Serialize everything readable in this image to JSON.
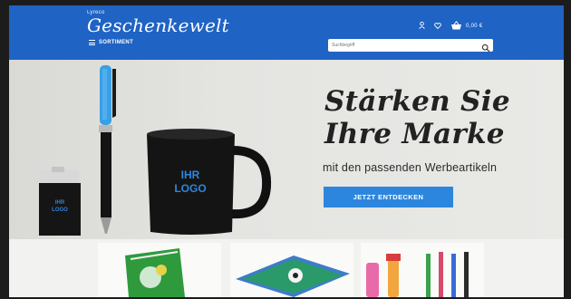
{
  "header": {
    "brand_small": "Lyreco",
    "brand_main": "Geschenkewelt",
    "menu_label": "SORTIMENT",
    "cart_label": "0,00 €",
    "search_placeholder": "Suchbegriff",
    "accent_color": "#1f63c4"
  },
  "hero": {
    "headline_line1": "Stärken Sie",
    "headline_line2": "Ihre Marke",
    "subline": "mit den passenden Werbeartikeln",
    "cta_label": "JETZT ENTDECKEN",
    "mug_text_line1": "IHR",
    "mug_text_line2": "LOGO",
    "lighter_text_line1": "IHR",
    "lighter_text_line2": "LOGO",
    "cta_color": "#2c86dd"
  },
  "icons": [
    "user-icon",
    "heart-icon",
    "cart-icon",
    "search-icon",
    "menu-icon"
  ]
}
